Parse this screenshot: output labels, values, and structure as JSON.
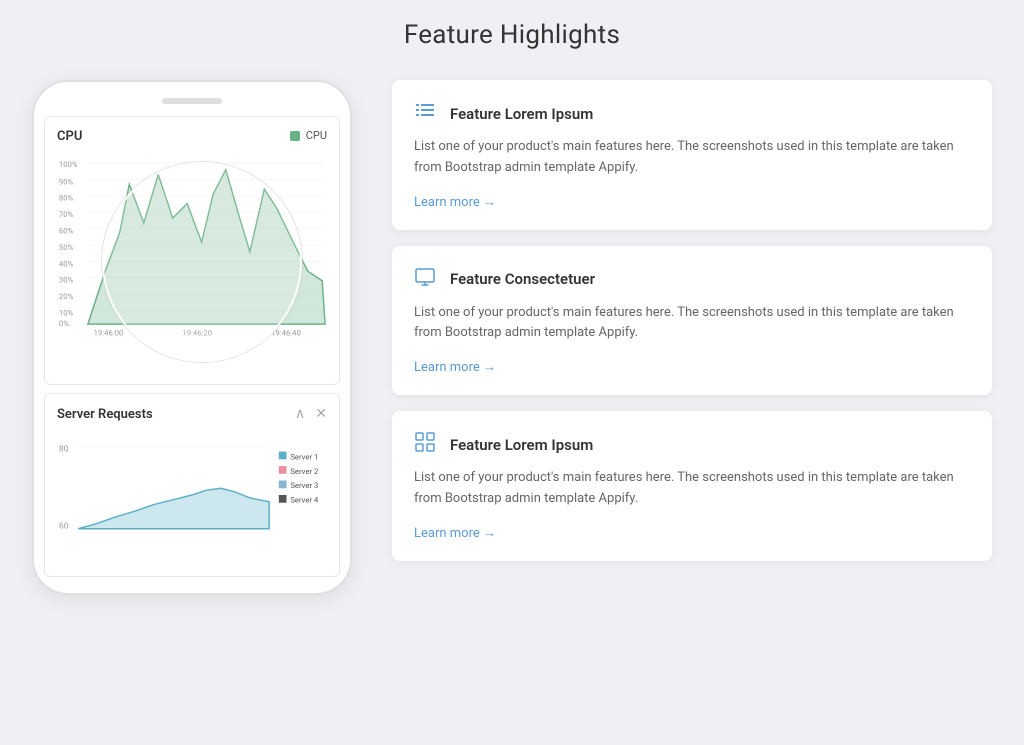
{
  "page": {
    "title": "Feature Highlights",
    "bg_color": "#eef0f4"
  },
  "phone": {
    "cpu_chart": {
      "title": "CPU",
      "legend_label": "CPU",
      "legend_color": "#6ab187",
      "y_labels": [
        "100%",
        "90%",
        "80%",
        "70%",
        "60%",
        "50%",
        "40%",
        "30%",
        "20%",
        "10%",
        "0%"
      ],
      "x_labels": [
        "19:46:00",
        "19:46:20",
        "19:46:40"
      ]
    },
    "server_chart": {
      "title": "Server Requests",
      "y_label_top": "80",
      "y_label_bottom": "60",
      "legend": [
        {
          "label": "Server 1",
          "color": "#5baec7"
        },
        {
          "label": "Server 2",
          "color": "#e88fa0"
        },
        {
          "label": "Server 3",
          "color": "#8ab4d4"
        },
        {
          "label": "Server 4",
          "color": "#555"
        }
      ]
    }
  },
  "features": [
    {
      "id": 1,
      "icon": "list-icon",
      "icon_char": "≡",
      "title": "Feature Lorem Ipsum",
      "description": "List one of your product's main features here. The screenshots used in this template are taken from Bootstrap admin template Appify.",
      "learn_more": "Learn more →"
    },
    {
      "id": 2,
      "icon": "monitor-icon",
      "icon_char": "⊡",
      "title": "Feature Consectetuer",
      "description": "List one of your product's main features here. The screenshots used in this template are taken from Bootstrap admin template Appify.",
      "learn_more": "Learn more →"
    },
    {
      "id": 3,
      "icon": "grid-icon",
      "icon_char": "⊞",
      "title": "Feature Lorem Ipsum",
      "description": "List one of your product's main features here. The screenshots used in this template are taken from Bootstrap admin template Appify.",
      "learn_more": "Learn more →"
    }
  ]
}
